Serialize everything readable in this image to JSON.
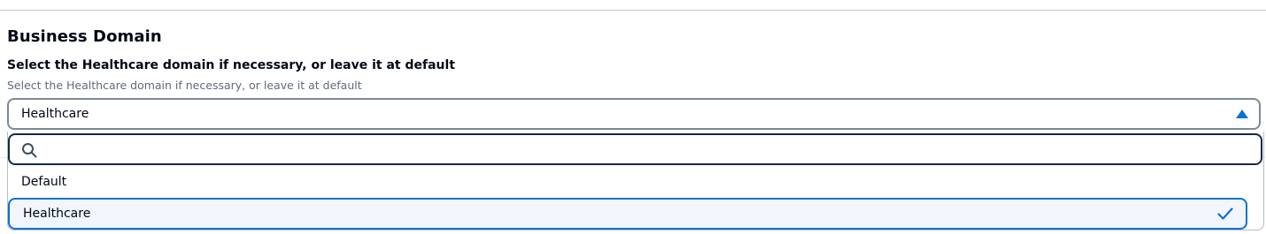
{
  "section": {
    "heading": "Business Domain"
  },
  "field": {
    "label": "Select the Healthcare domain if necessary, or leave it at default",
    "description": "Select the Healthcare domain if necessary, or leave it at default",
    "selected_value": "Healthcare",
    "expanded": true
  },
  "dropdown": {
    "search_value": "",
    "options": [
      {
        "label": "Default",
        "selected": false
      },
      {
        "label": "Healthcare",
        "selected": true
      }
    ]
  },
  "colors": {
    "accent": "#0972d3",
    "selected_background": "#f1f6fc",
    "focus_border": "#0f2a4a",
    "text": "#000716",
    "secondary_text": "#5f6b7a"
  },
  "icons": [
    "caret-up-icon",
    "search-icon",
    "check-icon"
  ]
}
